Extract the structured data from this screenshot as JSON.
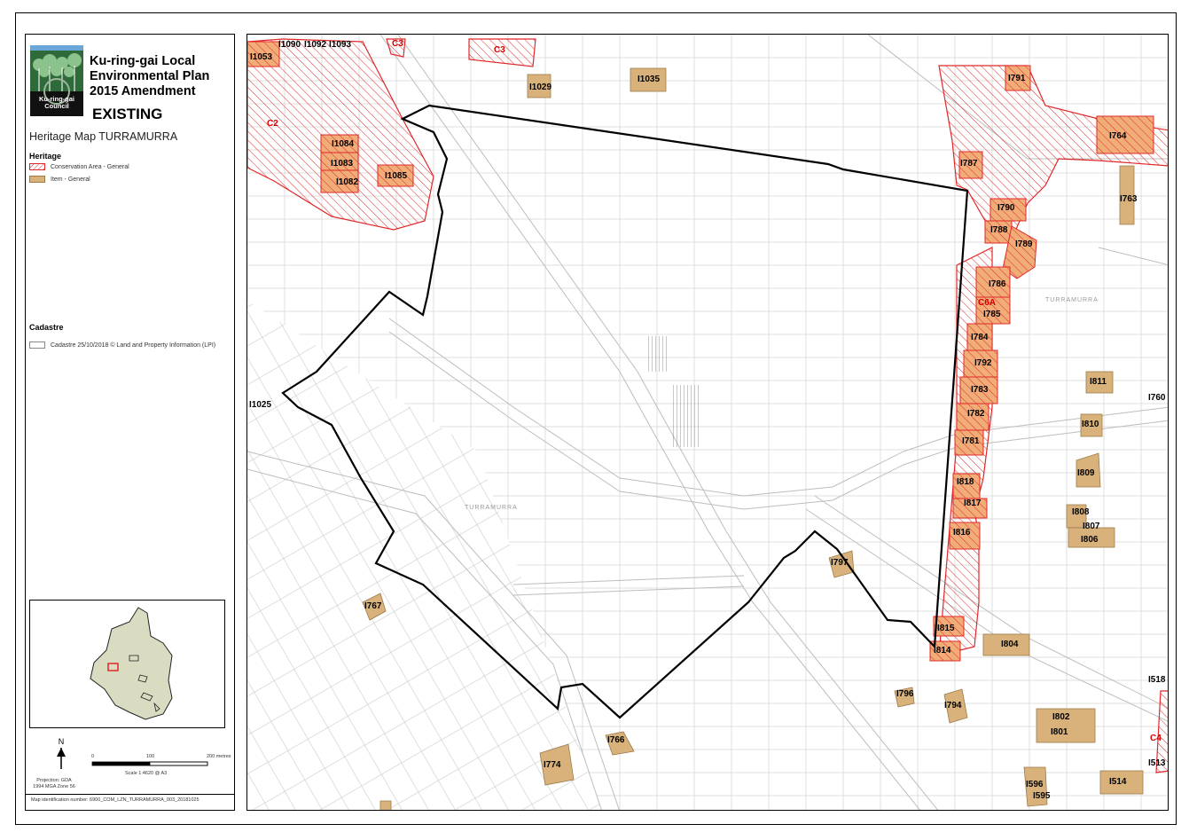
{
  "legend": {
    "title": "Ku-ring-gai Local Environmental Plan 2015 Amendment",
    "status": "EXISTING",
    "map_name": "Heritage Map TURRAMURRA",
    "logo_text": "Ku-ring-gai Council",
    "heritage_heading": "Heritage",
    "heritage_items": [
      {
        "label": "Conservation Area - General"
      },
      {
        "label": "Item - General"
      }
    ],
    "cadastre_heading": "Cadastre",
    "cadastre_item": "Cadastre 25/10/2018 © Land and Property Information (LPI)",
    "north": "N",
    "scale_ticks": [
      "0",
      "100",
      "200 metres"
    ],
    "scale_text": "Scale 1:4620 @ A3",
    "projection": "Projection: GDA 1994 MGA Zone 56",
    "map_id": "Map identification number: 6900_COM_LZN_TURRAMURRA_003_20181025"
  },
  "colors": {
    "conservation_stroke": "#e0282a",
    "item_fill": "#d8b27a",
    "boundary": "#000000"
  },
  "map": {
    "items": [
      {
        "id": "I1053"
      },
      {
        "id": "I1090"
      },
      {
        "id": "I1092"
      },
      {
        "id": "I1093"
      },
      {
        "id": "I1029"
      },
      {
        "id": "I1035"
      },
      {
        "id": "I1084"
      },
      {
        "id": "I1083"
      },
      {
        "id": "I1082"
      },
      {
        "id": "I1085"
      },
      {
        "id": "I1025"
      },
      {
        "id": "I767"
      },
      {
        "id": "I797"
      },
      {
        "id": "I766"
      },
      {
        "id": "I774"
      },
      {
        "id": "I796"
      },
      {
        "id": "I794"
      },
      {
        "id": "I791"
      },
      {
        "id": "I764"
      },
      {
        "id": "I787"
      },
      {
        "id": "I763"
      },
      {
        "id": "I790"
      },
      {
        "id": "I788"
      },
      {
        "id": "I789"
      },
      {
        "id": "I786"
      },
      {
        "id": "I785"
      },
      {
        "id": "I784"
      },
      {
        "id": "I792"
      },
      {
        "id": "I783"
      },
      {
        "id": "I782"
      },
      {
        "id": "I781"
      },
      {
        "id": "I811"
      },
      {
        "id": "I760"
      },
      {
        "id": "I810"
      },
      {
        "id": "I809"
      },
      {
        "id": "I818"
      },
      {
        "id": "I817"
      },
      {
        "id": "I816"
      },
      {
        "id": "I808"
      },
      {
        "id": "I807"
      },
      {
        "id": "I806"
      },
      {
        "id": "I815"
      },
      {
        "id": "I814"
      },
      {
        "id": "I804"
      },
      {
        "id": "I802"
      },
      {
        "id": "I801"
      },
      {
        "id": "I518"
      },
      {
        "id": "I513"
      },
      {
        "id": "I514"
      },
      {
        "id": "I596"
      },
      {
        "id": "I595"
      }
    ],
    "conservation_labels": [
      "C3",
      "C3",
      "C2",
      "C6A",
      "C4"
    ],
    "street_labels": [
      "TURRAMURRA",
      "TURRAMURRA"
    ]
  }
}
